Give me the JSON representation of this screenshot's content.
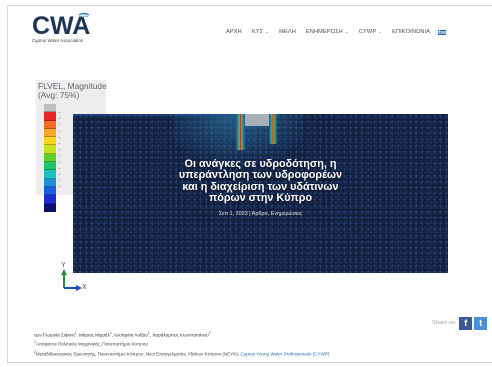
{
  "header": {
    "logo_text": "CWA",
    "logo_subtitle": "Cyprus Water Association",
    "nav": [
      {
        "label": "ΑΡΧΗ",
        "has_caret": false
      },
      {
        "label": "ΚΥΣ",
        "has_caret": true
      },
      {
        "label": "ΜΕΛΗ",
        "has_caret": false
      },
      {
        "label": "ΕΝΗΜΕΡΩΣΗ",
        "has_caret": true
      },
      {
        "label": "CYWP",
        "has_caret": true
      },
      {
        "label": "ΕΠΙΚΟΙΝΩΝΙΑ",
        "has_caret": false
      }
    ],
    "language_flag": "greek-flag-icon"
  },
  "figure": {
    "legend_title": "FLVEL, Magnitude",
    "legend_subtitle": "(Avg: 75%)",
    "legend_colors": [
      "#c0c0c0",
      "#e5262b",
      "#f26c23",
      "#f7a823",
      "#f5d61f",
      "#c6e21e",
      "#5bd12a",
      "#1fc66b",
      "#1ec1c0",
      "#1e8fd8",
      "#1d5ce0",
      "#1c2bd4",
      "#0b0f73"
    ],
    "axis_y": "Y",
    "axis_x": "X"
  },
  "article": {
    "title_lines": [
      "Οι ανάγκες σε υδροδότηση, η",
      "υπεράντληση των υδροφορέων",
      "και η διαχείριση των υδάτινων",
      "πόρων στην Κύπρο"
    ],
    "meta": "Σεπ 1, 2023 | Άρθρα, Ενημερώσεις"
  },
  "share": {
    "label": "Share on:",
    "facebook_glyph": "f",
    "twitter_glyph": "t"
  },
  "byline": {
    "prefix": "των Γεωργία Σιήκκη",
    "sup1": "1",
    "a2": ", Μάριος Μιχαήλ",
    "sup2": "1",
    "a3": ", Ιωσηφίνα Λοΐζου",
    "sup3": "1",
    "a4": ", Χαράλαμπος Κωνσταντίνου",
    "sup4": "2"
  },
  "affiliations": [
    {
      "sup": "1",
      "text": "Απόφοιτοι Πολιτικός Μηχανικός, Πανεπιστήμιο Κύπρου",
      "link": ""
    },
    {
      "sup": "2",
      "text": "Μεταδιδακτορικός Ερευνητής, Πανεπιστήμιο Κύπρου, Νέοι Επαγγελματίες Υδάτων Κύπρου (ΝΕΥΚ), ",
      "link": "Cyprus Young Water Professionals (CYWP)"
    }
  ]
}
